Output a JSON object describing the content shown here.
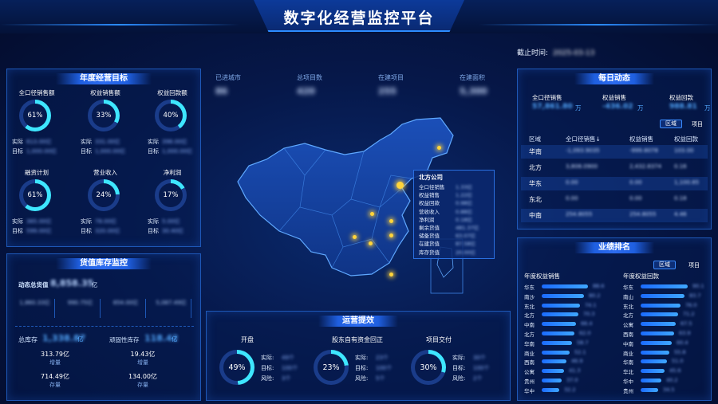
{
  "header": {
    "title": "数字化经营监控平台"
  },
  "deadline": {
    "label": "截止时间:",
    "value": "2025-03-13"
  },
  "annual_targets": {
    "title": "年度经营目标",
    "actual_label": "实际",
    "target_label": "目标",
    "items": [
      {
        "label": "全口径销售额",
        "percent": "61%",
        "actual": "613.00亿",
        "target": "1,000.00亿"
      },
      {
        "label": "权益销售额",
        "percent": "33%",
        "actual": "331.00亿",
        "target": "1,000.00亿"
      },
      {
        "label": "权益回款额",
        "percent": "40%",
        "actual": "398.00亿",
        "target": "1,000.00亿"
      },
      {
        "label": "融资计划",
        "percent": "61%",
        "actual": "365.00亿",
        "target": "599.00亿"
      },
      {
        "label": "营业收入",
        "percent": "24%",
        "actual": "78.00亿",
        "target": "320.00亿"
      },
      {
        "label": "净利润",
        "percent": "17%",
        "actual": "5.00亿",
        "target": "30.40亿"
      }
    ]
  },
  "inventory": {
    "title": "货值库存监控",
    "total_label": "动态总货值",
    "total_value": "8,858.35",
    "total_unit": "亿",
    "cells": [
      "1,860.33亿",
      "990.75亿",
      "854.00亿",
      "5,087.49亿"
    ],
    "stock_label": "总库存",
    "stock_value": "1,338.87",
    "stock_unit": "亿",
    "idle_label": "顽固性库存",
    "idle_value": "118.42",
    "idle_unit": "亿",
    "left_increase": "313.79亿",
    "left_increase_label": "增量",
    "left_stock": "714.49亿",
    "left_stock_label": "存量",
    "right_increase": "19.43亿",
    "right_increase_label": "增量",
    "right_stock": "134.00亿",
    "right_stock_label": "存量"
  },
  "center_stats": [
    {
      "label": "已进城市",
      "value": "86"
    },
    {
      "label": "总项目数",
      "value": "420"
    },
    {
      "label": "在建项目",
      "value": "255"
    },
    {
      "label": "在建面积",
      "value": "5,300"
    }
  ],
  "map_tooltip": {
    "title": "北方公司",
    "rows": [
      {
        "label": "全口径销售",
        "value": "1.33亿"
      },
      {
        "label": "权益销售",
        "value": "1.22亿"
      },
      {
        "label": "权益回款",
        "value": "0.98亿"
      },
      {
        "label": "营收收入",
        "value": "0.88亿"
      },
      {
        "label": "净利润",
        "value": "0.18亿"
      },
      {
        "label": "剩余货值",
        "value": "481.37亿"
      },
      {
        "label": "储备货值",
        "value": "63.07亿"
      },
      {
        "label": "在建货值",
        "value": "87.58亿"
      },
      {
        "label": "库存货值",
        "value": "20.00亿"
      }
    ]
  },
  "operations": {
    "title": "运营提效",
    "actual_label": "实际:",
    "target_label": "目标:",
    "risk_label": "风险:",
    "items": [
      {
        "label": "开盘",
        "percent": "49%",
        "actual": "49个",
        "target": "100个",
        "risk": "3个"
      },
      {
        "label": "股东自有资金回正",
        "percent": "23%",
        "actual": "23个",
        "target": "100个",
        "risk": "5个"
      },
      {
        "label": "项目交付",
        "percent": "30%",
        "actual": "30个",
        "target": "100个",
        "risk": "2个"
      }
    ]
  },
  "daily": {
    "title": "每日动态",
    "summary": [
      {
        "label": "全口径销售",
        "value": "57,861.80",
        "unit": "万"
      },
      {
        "label": "权益销售",
        "value": "-436.02",
        "unit": "万"
      },
      {
        "label": "权益回款",
        "value": "988.81",
        "unit": "万"
      }
    ],
    "tabs": [
      "区域",
      "项目"
    ],
    "columns": [
      "区域",
      "全口径销售↓",
      "权益销售",
      "权益回款"
    ],
    "rows": [
      {
        "region": "华南",
        "sales": "-1,093.9035",
        "equity": "-999.8078",
        "collection": "103.00"
      },
      {
        "region": "北方",
        "sales": "3,808.0900",
        "equity": "2,432.8374",
        "collection": "0.16"
      },
      {
        "region": "华东",
        "sales": "0.00",
        "equity": "0.00",
        "collection": "1,100.85"
      },
      {
        "region": "东北",
        "sales": "0.00",
        "equity": "0.00",
        "collection": "0.18"
      },
      {
        "region": "中南",
        "sales": "254.8055",
        "equity": "254.8055",
        "collection": "4.46"
      }
    ]
  },
  "ranking": {
    "title": "业绩排名",
    "tabs": [
      "区域",
      "项目"
    ],
    "left_title": "年度权益销售",
    "right_title": "年度权益回款",
    "left": [
      {
        "name": "华东",
        "value": 0.93,
        "text": "88.6"
      },
      {
        "name": "南沙",
        "value": 0.85,
        "text": "80.2"
      },
      {
        "name": "东北",
        "value": 0.78,
        "text": "74.1"
      },
      {
        "name": "北方",
        "value": 0.74,
        "text": "70.3"
      },
      {
        "name": "中南",
        "value": 0.7,
        "text": "66.4"
      },
      {
        "name": "北方",
        "value": 0.66,
        "text": "62.0"
      },
      {
        "name": "华南",
        "value": 0.62,
        "text": "58.7"
      },
      {
        "name": "商业",
        "value": 0.56,
        "text": "52.1"
      },
      {
        "name": "西南",
        "value": 0.5,
        "text": "46.9"
      },
      {
        "name": "公寓",
        "value": 0.45,
        "text": "41.3"
      },
      {
        "name": "贵州",
        "value": 0.4,
        "text": "37.0"
      },
      {
        "name": "华中",
        "value": 0.35,
        "text": "32.2"
      }
    ],
    "right": [
      {
        "name": "华东",
        "value": 0.95,
        "text": "90.1"
      },
      {
        "name": "南山",
        "value": 0.88,
        "text": "83.7"
      },
      {
        "name": "东北",
        "value": 0.8,
        "text": "76.0"
      },
      {
        "name": "北方",
        "value": 0.75,
        "text": "71.2"
      },
      {
        "name": "公寓",
        "value": 0.71,
        "text": "67.5"
      },
      {
        "name": "西南",
        "value": 0.67,
        "text": "63.9"
      },
      {
        "name": "中南",
        "value": 0.63,
        "text": "60.4"
      },
      {
        "name": "商业",
        "value": 0.58,
        "text": "55.8"
      },
      {
        "name": "华南",
        "value": 0.54,
        "text": "51.0"
      },
      {
        "name": "华北",
        "value": 0.48,
        "text": "45.6"
      },
      {
        "name": "华中",
        "value": 0.42,
        "text": "40.2"
      },
      {
        "name": "贵州",
        "value": 0.36,
        "text": "34.5"
      }
    ]
  },
  "colors": {
    "accent": "#2d8cff",
    "ring": "#3ee6ff",
    "dot": "#ffd43a"
  }
}
